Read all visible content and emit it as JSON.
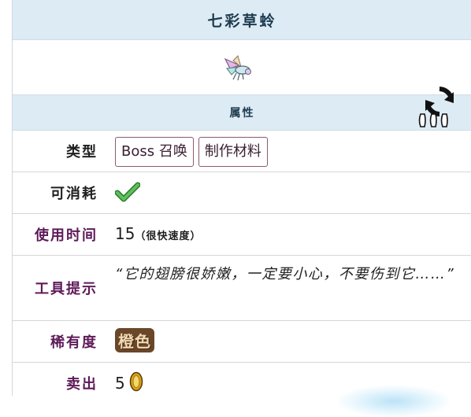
{
  "title": "七彩草蛉",
  "section_header": "属性",
  "rows": {
    "type": {
      "label": "类型",
      "tags": [
        "Boss 召唤",
        "制作材料"
      ]
    },
    "consumable": {
      "label": "可消耗"
    },
    "use_time": {
      "label": "使用时间",
      "value": "15",
      "note": "（很快速度）"
    },
    "tooltip": {
      "label": "工具提示",
      "text": "“它的翅膀很娇嫩，一定要小心，不要伤到它……”"
    },
    "rarity": {
      "label": "稀有度",
      "value": "橙色"
    },
    "sell": {
      "label": "卖出",
      "value": "5"
    }
  },
  "icons": {
    "item": "prismatic-lacewing-icon",
    "toggle": "switch-image-icon",
    "check": "checkmark-icon",
    "coin": "gold-coin-icon"
  },
  "colors": {
    "header_bg": "#dcebf4",
    "label_purple": "#5e1b59",
    "check_green": "#3c9c3c",
    "rarity_bg": "#6a4728"
  }
}
